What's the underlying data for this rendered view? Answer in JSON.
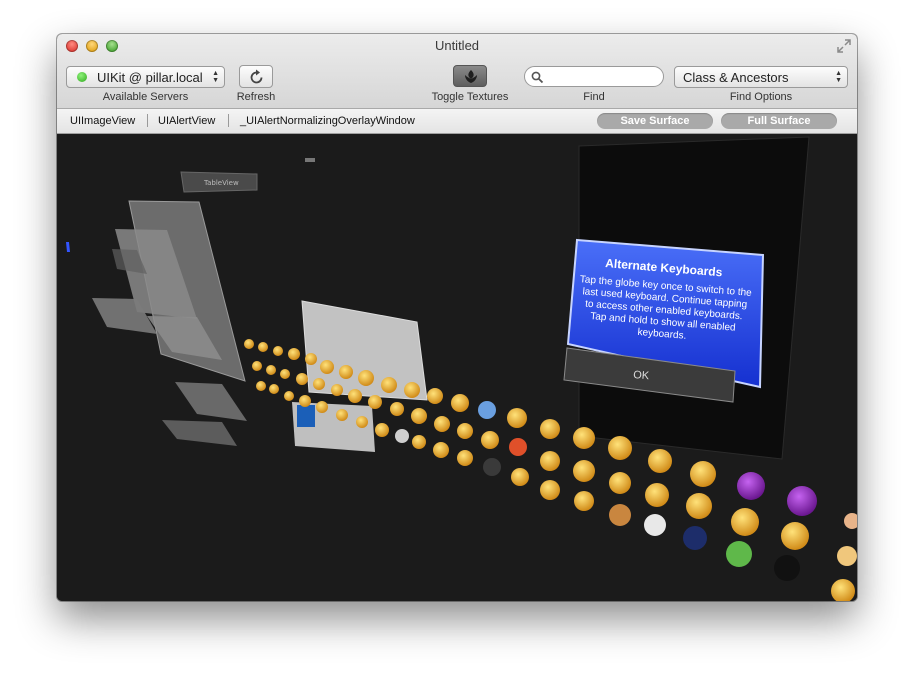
{
  "window": {
    "title": "Untitled"
  },
  "toolbar": {
    "server": "UIKit @ pillar.local",
    "available_servers_label": "Available Servers",
    "refresh_label": "Refresh",
    "toggle_textures_label": "Toggle Textures",
    "search_value": "",
    "find_label": "Find",
    "find_options_value": "Class & Ancestors",
    "find_options_label": "Find Options"
  },
  "pathbar": {
    "crumbs": [
      "UIImageView",
      "UIAlertView",
      "_UIAlertNormalizingOverlayWindow"
    ],
    "save_surface": "Save Surface",
    "full_surface": "Full Surface"
  },
  "canvas": {
    "small_label": "TableView",
    "alert": {
      "title": "Alternate Keyboards",
      "message": "Tap the globe key once to switch to the last used keyboard. Continue tapping to access other enabled keyboards. Tap and hold to show all enabled keyboards.",
      "ok": "OK"
    }
  },
  "colors": {
    "alert_blue": "#1f3fe0",
    "status_green": "#2ea81c",
    "canvas_bg": "#1b1b1b"
  }
}
